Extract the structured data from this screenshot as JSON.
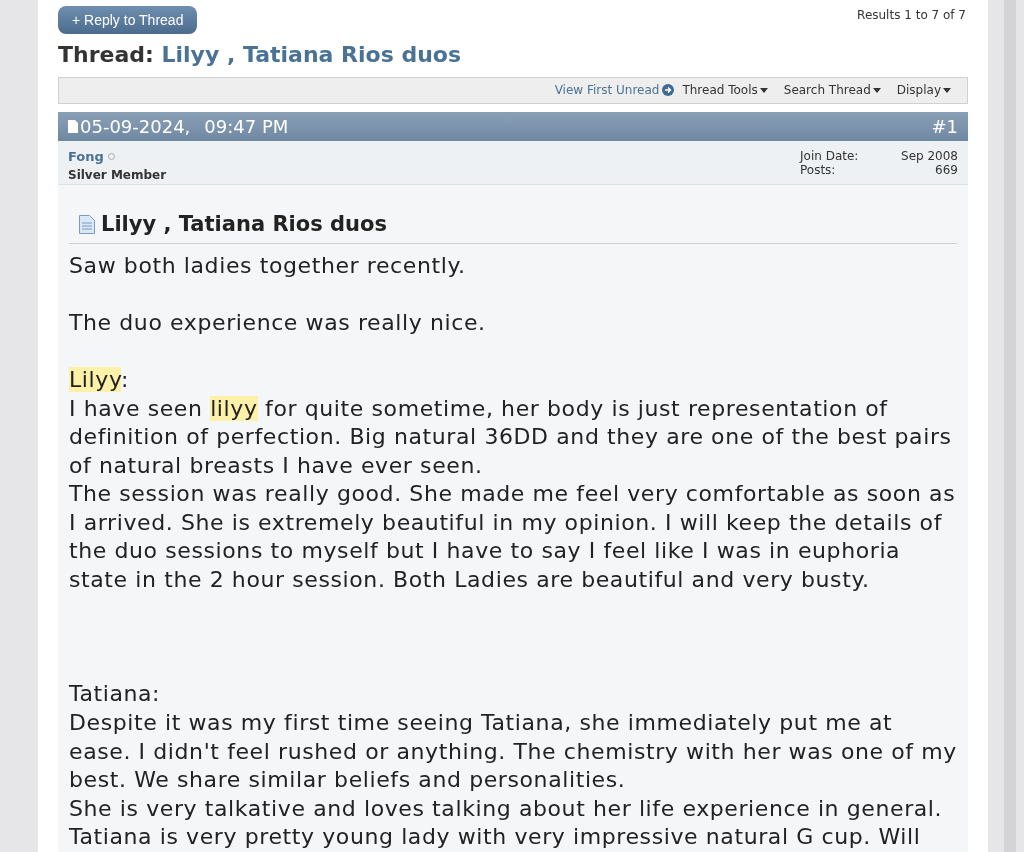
{
  "reply_button": {
    "label": "+ Reply to Thread"
  },
  "results": "Results 1 to 7 of 7",
  "thread_title": {
    "prefix": "Thread:",
    "title": "Lilyy , Tatiana Rios duos"
  },
  "toolbar": [
    {
      "label": "View First Unread",
      "kind": "link"
    },
    {
      "label": "Thread Tools",
      "kind": "menu"
    },
    {
      "label": "Search Thread",
      "kind": "menu"
    },
    {
      "label": "Display",
      "kind": "menu"
    }
  ],
  "post": {
    "date": "05-09-2024,",
    "time": "09:47 PM",
    "number": "#1",
    "author": {
      "name": "Fong",
      "online": false,
      "rank": "Silver Member"
    },
    "stats": [
      {
        "label": "Join Date:",
        "value": "Sep 2008"
      },
      {
        "label": "Posts:",
        "value": "669"
      }
    ],
    "title": "Lilyy , Tatiana Rios duos",
    "body": [
      {
        "text": "Saw both ladies together recently.\n\nThe duo experience was really nice.\n\n",
        "highlighted": false
      },
      {
        "text": "Lilyy",
        "highlighted": true
      },
      {
        "text": ":\nI have seen ",
        "highlighted": false
      },
      {
        "text": "lilyy",
        "highlighted": true
      },
      {
        "text": " for quite sometime, her body is just representation of definition of perfection. Big natural 36DD and they are one of the best pairs of natural breasts I have ever seen.\nThe session was really good. She made me feel very comfortable as soon as I arrived. She is extremely beautiful in my opinion. I will keep the details of the duo sessions to myself but I have to say I feel like I was in euphoria state in the 2 hour session. Both Ladies are beautiful and very busty.\n\n\n\nTatiana:\nDespite it was my first time seeing Tatiana, she immediately put me at ease. I didn't feel rushed or anything. The chemistry with her was one of my best. We share similar beliefs and personalities.\nShe is very talkative and loves talking about her life experience in general.\nTatiana is very pretty young lady with very impressive natural G cup. Will",
        "highlighted": false
      }
    ]
  }
}
